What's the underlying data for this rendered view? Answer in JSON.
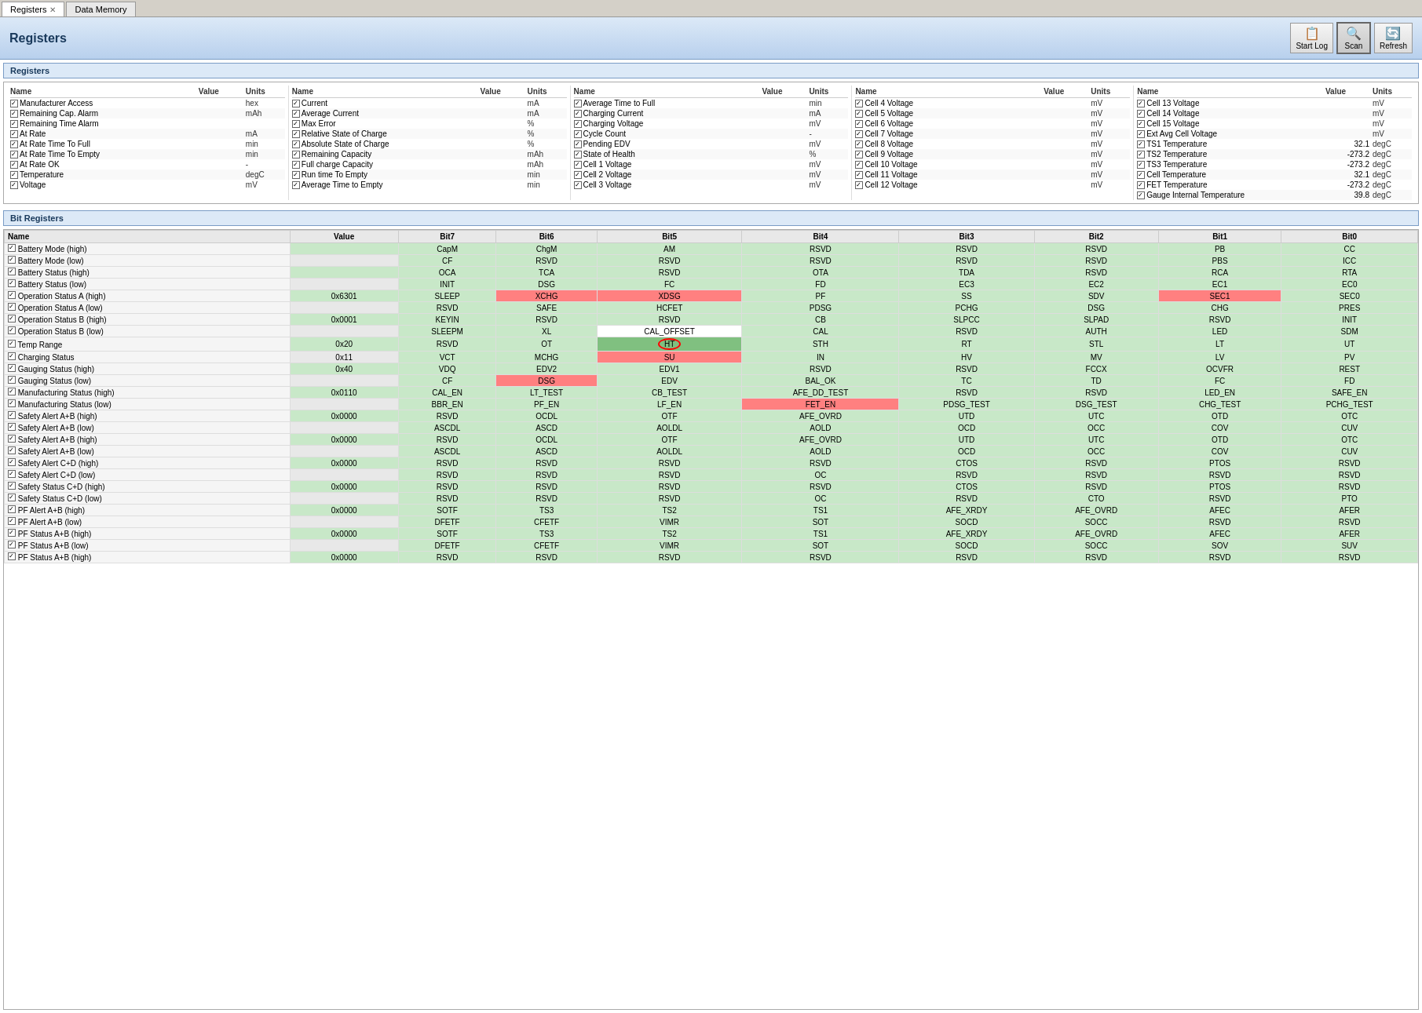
{
  "tabs": [
    {
      "label": "Registers",
      "active": true,
      "closeable": true
    },
    {
      "label": "Data Memory",
      "active": false,
      "closeable": false
    }
  ],
  "page": {
    "title": "Registers",
    "section_registers": "Registers",
    "section_bit_registers": "Bit Registers"
  },
  "toolbar": {
    "start_log_label": "Start Log",
    "scan_label": "Scan",
    "refresh_label": "Refresh"
  },
  "columns": [
    {
      "headers": [
        "Name",
        "Value",
        "Units"
      ],
      "rows": [
        {
          "name": "Manufacturer Access",
          "value": "",
          "unit": "hex",
          "checked": true
        },
        {
          "name": "Remaining Cap. Alarm",
          "value": "",
          "unit": "mAh",
          "checked": true
        },
        {
          "name": "Remaining Time Alarm",
          "value": "",
          "unit": "",
          "checked": true
        },
        {
          "name": "At Rate",
          "value": "",
          "unit": "mA",
          "checked": true
        },
        {
          "name": "At Rate Time To Full",
          "value": "",
          "unit": "min",
          "checked": true
        },
        {
          "name": "At Rate Time To Empty",
          "value": "",
          "unit": "min",
          "checked": true
        },
        {
          "name": "At Rate OK",
          "value": "",
          "unit": "-",
          "checked": true
        },
        {
          "name": "Temperature",
          "value": "",
          "unit": "degC",
          "checked": true
        },
        {
          "name": "Voltage",
          "value": "",
          "unit": "mV",
          "checked": true
        }
      ]
    },
    {
      "headers": [
        "Name",
        "Value",
        "Units"
      ],
      "rows": [
        {
          "name": "Current",
          "value": "",
          "unit": "mA",
          "checked": true
        },
        {
          "name": "Average Current",
          "value": "",
          "unit": "mA",
          "checked": true
        },
        {
          "name": "Max Error",
          "value": "",
          "unit": "%",
          "checked": true
        },
        {
          "name": "Relative State of Charge",
          "value": "",
          "unit": "%",
          "checked": true
        },
        {
          "name": "Absolute State of Charge",
          "value": "",
          "unit": "%",
          "checked": true
        },
        {
          "name": "Remaining Capacity",
          "value": "",
          "unit": "mAh",
          "checked": true
        },
        {
          "name": "Full charge Capacity",
          "value": "",
          "unit": "mAh",
          "checked": true
        },
        {
          "name": "Run time To Empty",
          "value": "",
          "unit": "min",
          "checked": true
        },
        {
          "name": "Average Time to Empty",
          "value": "",
          "unit": "min",
          "checked": true
        }
      ]
    },
    {
      "headers": [
        "Name",
        "Value",
        "Units"
      ],
      "rows": [
        {
          "name": "Average Time to Full",
          "value": "",
          "unit": "min",
          "checked": true
        },
        {
          "name": "Charging Current",
          "value": "",
          "unit": "mA",
          "checked": true
        },
        {
          "name": "Charging Voltage",
          "value": "",
          "unit": "mV",
          "checked": true
        },
        {
          "name": "Cycle Count",
          "value": "",
          "unit": "-",
          "checked": true
        },
        {
          "name": "Pending EDV",
          "value": "",
          "unit": "mV",
          "checked": true
        },
        {
          "name": "State of Health",
          "value": "",
          "unit": "%",
          "checked": true
        },
        {
          "name": "Cell 1 Voltage",
          "value": "",
          "unit": "mV",
          "checked": true
        },
        {
          "name": "Cell 2 Voltage",
          "value": "",
          "unit": "mV",
          "checked": true
        },
        {
          "name": "Cell 3 Voltage",
          "value": "",
          "unit": "mV",
          "checked": true
        }
      ]
    },
    {
      "headers": [
        "Name",
        "Value",
        "Units"
      ],
      "rows": [
        {
          "name": "Cell 4 Voltage",
          "value": "",
          "unit": "mV",
          "checked": true
        },
        {
          "name": "Cell 5 Voltage",
          "value": "",
          "unit": "mV",
          "checked": true
        },
        {
          "name": "Cell 6 Voltage",
          "value": "",
          "unit": "mV",
          "checked": true
        },
        {
          "name": "Cell 7 Voltage",
          "value": "",
          "unit": "mV",
          "checked": true
        },
        {
          "name": "Cell 8 Voltage",
          "value": "",
          "unit": "mV",
          "checked": true
        },
        {
          "name": "Cell 9 Voltage",
          "value": "",
          "unit": "mV",
          "checked": true
        },
        {
          "name": "Cell 10 Voltage",
          "value": "",
          "unit": "mV",
          "checked": true
        },
        {
          "name": "Cell 11 Voltage",
          "value": "",
          "unit": "mV",
          "checked": true
        },
        {
          "name": "Cell 12 Voltage",
          "value": "",
          "unit": "mV",
          "checked": true
        }
      ]
    },
    {
      "headers": [
        "Name",
        "Value",
        "Units"
      ],
      "rows": [
        {
          "name": "Cell 13 Voltage",
          "value": "",
          "unit": "mV",
          "checked": true
        },
        {
          "name": "Cell 14 Voltage",
          "value": "",
          "unit": "mV",
          "checked": true
        },
        {
          "name": "Cell 15 Voltage",
          "value": "",
          "unit": "mV",
          "checked": true
        },
        {
          "name": "Ext Avg Cell Voltage",
          "value": "",
          "unit": "mV",
          "checked": true
        },
        {
          "name": "TS1 Temperature",
          "value": "32.1",
          "unit": "degC",
          "checked": true
        },
        {
          "name": "TS2 Temperature",
          "value": "-273.2",
          "unit": "degC",
          "checked": true
        },
        {
          "name": "TS3 Temperature",
          "value": "-273.2",
          "unit": "degC",
          "checked": true
        },
        {
          "name": "Cell Temperature",
          "value": "32.1",
          "unit": "degC",
          "checked": true
        },
        {
          "name": "FET Temperature",
          "value": "-273.2",
          "unit": "degC",
          "checked": true
        },
        {
          "name": "Gauge Internal Temperature",
          "value": "39.8",
          "unit": "degC",
          "checked": true
        }
      ]
    }
  ],
  "bit_table": {
    "headers": [
      "Name",
      "Value",
      "Bit7",
      "Bit6",
      "Bit5",
      "Bit4",
      "Bit3",
      "Bit2",
      "Bit1",
      "Bit0"
    ],
    "rows": [
      {
        "name": "Battery Mode (high)",
        "value": "",
        "type": "high",
        "cells": [
          "CapM",
          "ChgM",
          "AM",
          "RSVD",
          "RSVD",
          "RSVD",
          "PB",
          "CC"
        ],
        "colors": [
          "green",
          "green",
          "green",
          "green",
          "green",
          "green",
          "green",
          "green"
        ]
      },
      {
        "name": "Battery Mode (low)",
        "value": "",
        "type": "low",
        "cells": [
          "CF",
          "RSVD",
          "RSVD",
          "RSVD",
          "RSVD",
          "RSVD",
          "PBS",
          "ICC"
        ],
        "colors": [
          "green",
          "green",
          "green",
          "green",
          "green",
          "green",
          "green",
          "green"
        ]
      },
      {
        "name": "Battery Status (high)",
        "value": "",
        "type": "high",
        "cells": [
          "OCA",
          "TCA",
          "RSVD",
          "OTA",
          "TDA",
          "RSVD",
          "RCA",
          "RTA"
        ],
        "colors": [
          "green",
          "green",
          "green",
          "green",
          "green",
          "green",
          "green",
          "green"
        ]
      },
      {
        "name": "Battery Status (low)",
        "value": "",
        "type": "low",
        "cells": [
          "INIT",
          "DSG",
          "FC",
          "FD",
          "EC3",
          "EC2",
          "EC1",
          "EC0"
        ],
        "colors": [
          "green",
          "green",
          "green",
          "green",
          "green",
          "green",
          "green",
          "green"
        ]
      },
      {
        "name": "Operation Status A (high)",
        "value": "0x6301",
        "type": "high",
        "cells": [
          "SLEEP",
          "XCHG",
          "XDSG",
          "PF",
          "SS",
          "SDV",
          "SEC1",
          "SEC0"
        ],
        "colors": [
          "green",
          "red",
          "red",
          "green",
          "green",
          "green",
          "red",
          "green"
        ]
      },
      {
        "name": "Operation Status A (low)",
        "value": "",
        "type": "low",
        "cells": [
          "RSVD",
          "SAFE",
          "HCFET",
          "PDSG",
          "PCHG",
          "DSG",
          "CHG",
          "PRES"
        ],
        "colors": [
          "green",
          "green",
          "green",
          "green",
          "green",
          "green",
          "green",
          "green"
        ]
      },
      {
        "name": "Operation Status B (high)",
        "value": "0x0001",
        "type": "high",
        "cells": [
          "KEYIN",
          "RSVD",
          "RSVD",
          "CB",
          "SLPCC",
          "SLPAD",
          "RSVD",
          "INIT"
        ],
        "colors": [
          "green",
          "green",
          "green",
          "green",
          "green",
          "green",
          "green",
          "green"
        ]
      },
      {
        "name": "Operation Status B (low)",
        "value": "",
        "type": "low",
        "cells": [
          "SLEEPM",
          "XL",
          "CAL_OFFSET",
          "CAL",
          "RSVD",
          "AUTH",
          "LED",
          "SDM"
        ],
        "colors": [
          "green",
          "green",
          "white",
          "green",
          "green",
          "green",
          "green",
          "green"
        ]
      },
      {
        "name": "Temp Range",
        "value": "0x20",
        "type": "high",
        "cells": [
          "RSVD",
          "OT",
          "HT",
          "STH",
          "RT",
          "STL",
          "LT",
          "UT"
        ],
        "colors": [
          "green",
          "green",
          "circle",
          "green",
          "green",
          "green",
          "green",
          "green"
        ]
      },
      {
        "name": "Charging Status",
        "value": "0x11",
        "type": "low",
        "cells": [
          "VCT",
          "MCHG",
          "SU",
          "IN",
          "HV",
          "MV",
          "LV",
          "PV"
        ],
        "colors": [
          "green",
          "green",
          "red",
          "green",
          "green",
          "green",
          "green",
          "green"
        ]
      },
      {
        "name": "Gauging Status (high)",
        "value": "0x40",
        "type": "high",
        "cells": [
          "VDQ",
          "EDV2",
          "EDV1",
          "RSVD",
          "RSVD",
          "FCCX",
          "OCVFR",
          "REST"
        ],
        "colors": [
          "green",
          "green",
          "green",
          "green",
          "green",
          "green",
          "green",
          "green"
        ]
      },
      {
        "name": "Gauging Status (low)",
        "value": "",
        "type": "low",
        "cells": [
          "CF",
          "DSG",
          "EDV",
          "BAL_OK",
          "TC",
          "TD",
          "FC",
          "FD"
        ],
        "colors": [
          "green",
          "red",
          "green",
          "green",
          "green",
          "green",
          "green",
          "green"
        ]
      },
      {
        "name": "Manufacturing Status (high)",
        "value": "0x0110",
        "type": "high",
        "cells": [
          "CAL_EN",
          "LT_TEST",
          "CB_TEST",
          "AFE_DD_TEST",
          "RSVD",
          "RSVD",
          "LED_EN",
          "SAFE_EN"
        ],
        "colors": [
          "green",
          "green",
          "green",
          "green",
          "green",
          "green",
          "green",
          "green"
        ]
      },
      {
        "name": "Manufacturing Status (low)",
        "value": "",
        "type": "low",
        "cells": [
          "BBR_EN",
          "PF_EN",
          "LF_EN",
          "FET_EN",
          "PDSG_TEST",
          "DSG_TEST",
          "CHG_TEST",
          "PCHG_TEST"
        ],
        "colors": [
          "green",
          "green",
          "green",
          "red",
          "green",
          "green",
          "green",
          "green"
        ]
      },
      {
        "name": "Safety Alert A+B (high)",
        "value": "0x0000",
        "type": "high",
        "cells": [
          "RSVD",
          "OCDL",
          "OTF",
          "AFE_OVRD",
          "UTD",
          "UTC",
          "OTD",
          "OTC"
        ],
        "colors": [
          "green",
          "green",
          "green",
          "green",
          "green",
          "green",
          "green",
          "green"
        ]
      },
      {
        "name": "Safety Alert A+B (low)",
        "value": "",
        "type": "low",
        "cells": [
          "ASCDL",
          "ASCD",
          "AOLDL",
          "AOLD",
          "OCD",
          "OCC",
          "COV",
          "CUV"
        ],
        "colors": [
          "green",
          "green",
          "green",
          "green",
          "green",
          "green",
          "green",
          "green"
        ]
      },
      {
        "name": "Safety Alert A+B (high)",
        "value": "0x0000",
        "type": "high",
        "cells": [
          "RSVD",
          "OCDL",
          "OTF",
          "AFE_OVRD",
          "UTD",
          "UTC",
          "OTD",
          "OTC"
        ],
        "colors": [
          "green",
          "green",
          "green",
          "green",
          "green",
          "green",
          "green",
          "green"
        ]
      },
      {
        "name": "Safety Alert A+B (low)",
        "value": "",
        "type": "low",
        "cells": [
          "ASCDL",
          "ASCD",
          "AOLDL",
          "AOLD",
          "OCD",
          "OCC",
          "COV",
          "CUV"
        ],
        "colors": [
          "green",
          "green",
          "green",
          "green",
          "green",
          "green",
          "green",
          "green"
        ]
      },
      {
        "name": "Safety Alert C+D (high)",
        "value": "0x0000",
        "type": "high",
        "cells": [
          "RSVD",
          "RSVD",
          "RSVD",
          "RSVD",
          "CTOS",
          "RSVD",
          "PTOS",
          "RSVD"
        ],
        "colors": [
          "green",
          "green",
          "green",
          "green",
          "green",
          "green",
          "green",
          "green"
        ]
      },
      {
        "name": "Safety Alert C+D (low)",
        "value": "",
        "type": "low",
        "cells": [
          "RSVD",
          "RSVD",
          "RSVD",
          "OC",
          "RSVD",
          "RSVD",
          "RSVD",
          "RSVD"
        ],
        "colors": [
          "green",
          "green",
          "green",
          "green",
          "green",
          "green",
          "green",
          "green"
        ]
      },
      {
        "name": "Safety Status C+D (high)",
        "value": "0x0000",
        "type": "high",
        "cells": [
          "RSVD",
          "RSVD",
          "RSVD",
          "RSVD",
          "CTOS",
          "RSVD",
          "PTOS",
          "RSVD"
        ],
        "colors": [
          "green",
          "green",
          "green",
          "green",
          "green",
          "green",
          "green",
          "green"
        ]
      },
      {
        "name": "Safety Status C+D (low)",
        "value": "",
        "type": "low",
        "cells": [
          "RSVD",
          "RSVD",
          "RSVD",
          "OC",
          "RSVD",
          "CTO",
          "RSVD",
          "PTO"
        ],
        "colors": [
          "green",
          "green",
          "green",
          "green",
          "green",
          "green",
          "green",
          "green"
        ]
      },
      {
        "name": "PF Alert A+B (high)",
        "value": "0x0000",
        "type": "high",
        "cells": [
          "SOTF",
          "TS3",
          "TS2",
          "TS1",
          "AFE_XRDY",
          "AFE_OVRD",
          "AFEC",
          "AFER"
        ],
        "colors": [
          "green",
          "green",
          "green",
          "green",
          "green",
          "green",
          "green",
          "green"
        ]
      },
      {
        "name": "PF Alert A+B (low)",
        "value": "",
        "type": "low",
        "cells": [
          "DFETF",
          "CFETF",
          "VIMR",
          "SOT",
          "SOCD",
          "SOCC",
          "RSVD",
          "RSVD"
        ],
        "colors": [
          "green",
          "green",
          "green",
          "green",
          "green",
          "green",
          "green",
          "green"
        ]
      },
      {
        "name": "PF Status A+B (high)",
        "value": "0x0000",
        "type": "high",
        "cells": [
          "SOTF",
          "TS3",
          "TS2",
          "TS1",
          "AFE_XRDY",
          "AFE_OVRD",
          "AFEC",
          "AFER"
        ],
        "colors": [
          "green",
          "green",
          "green",
          "green",
          "green",
          "green",
          "green",
          "green"
        ]
      },
      {
        "name": "PF Status A+B (low)",
        "value": "",
        "type": "low",
        "cells": [
          "DFETF",
          "CFETF",
          "VIMR",
          "SOT",
          "SOCD",
          "SOCC",
          "SOV",
          "SUV"
        ],
        "colors": [
          "green",
          "green",
          "green",
          "green",
          "green",
          "green",
          "green",
          "green"
        ]
      },
      {
        "name": "PF Status A+B (high)",
        "value": "0x0000",
        "type": "high",
        "cells": [
          "RSVD",
          "RSVD",
          "RSVD",
          "RSVD",
          "RSVD",
          "RSVD",
          "RSVD",
          "RSVD"
        ],
        "colors": [
          "green",
          "green",
          "green",
          "green",
          "green",
          "green",
          "green",
          "green"
        ]
      }
    ]
  }
}
